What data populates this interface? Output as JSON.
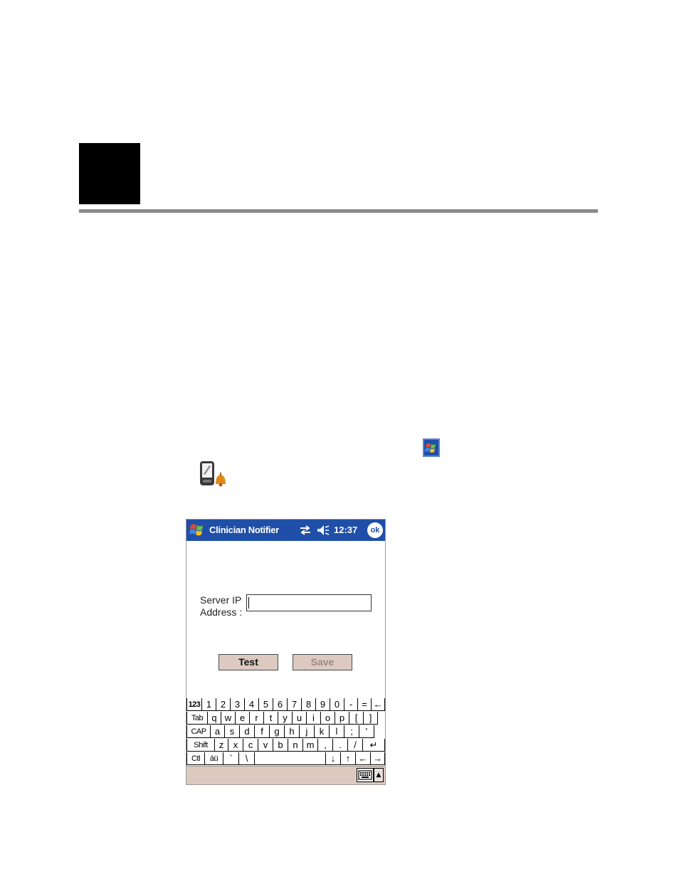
{
  "window": {
    "title": "Clinician Notifier",
    "time": "12:37",
    "ok_label": "ok",
    "start_icon": "windows-start-icon",
    "connectivity_icon": "connectivity-arrows-icon",
    "speaker_icon": "speaker-icon"
  },
  "form": {
    "server_ip_label_line1": "Server IP",
    "server_ip_label_line2": "Address :",
    "server_ip_value": "",
    "test_label": "Test",
    "save_label": "Save"
  },
  "keyboard": {
    "row1": [
      "123",
      "1",
      "2",
      "3",
      "4",
      "5",
      "6",
      "7",
      "8",
      "9",
      "0",
      "-",
      "=",
      "←"
    ],
    "row2": [
      "Tab",
      "q",
      "w",
      "e",
      "r",
      "t",
      "y",
      "u",
      "i",
      "o",
      "p",
      "[",
      "]"
    ],
    "row3": [
      "CAP",
      "a",
      "s",
      "d",
      "f",
      "g",
      "h",
      "j",
      "k",
      "l",
      ";",
      "'"
    ],
    "row4": [
      "Shift",
      "z",
      "x",
      "c",
      "v",
      "b",
      "n",
      "m",
      ",",
      ".",
      "/",
      "↵"
    ],
    "row5": [
      "Ctl",
      "áü",
      "`",
      "\\",
      "",
      "↓",
      "↑",
      "←",
      "→"
    ]
  },
  "colors": {
    "titlebar": "#1f4fa8",
    "button_face": "#dcc9c0",
    "chapter_block": "#000000",
    "rule": "#8a8a8a"
  }
}
